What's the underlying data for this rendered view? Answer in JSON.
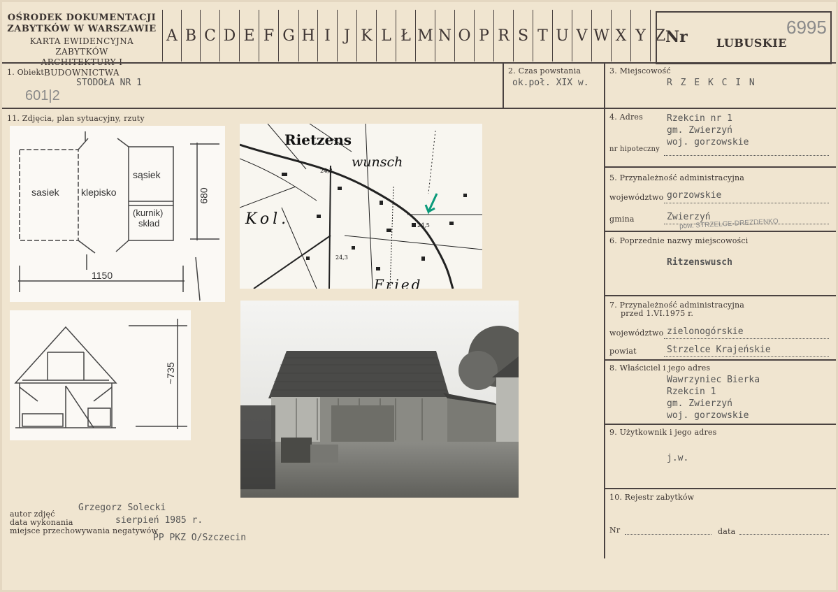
{
  "institution": {
    "line1": "OŚRODEK DOKUMENTACJI",
    "line2": "ZABYTKÓW W WARSZAWIE",
    "line3": "KARTA EWIDENCYJNA ZABYTKÓW",
    "line4": "ARCHITEKTURY I BUDOWNICTWA"
  },
  "letters": [
    "A",
    "B",
    "C",
    "D",
    "E",
    "F",
    "G",
    "H",
    "I",
    "J",
    "K",
    "L",
    "Ł",
    "M",
    "N",
    "O",
    "P",
    "R",
    "S",
    "T",
    "U",
    "V",
    "W",
    "X",
    "Y",
    "Z"
  ],
  "nr_box": {
    "label": "Nr",
    "region": "LUBUSKIE",
    "number": "6995"
  },
  "field1": {
    "label": "1. Obiekt",
    "value": "STODOŁA NR 1",
    "handwritten": "601|2"
  },
  "field2": {
    "label": "2. Czas powstania",
    "value": "ok.poł. XIX w."
  },
  "field3": {
    "label": "3. Miejscowość",
    "value": "R Z E K C I N"
  },
  "field11": {
    "label": "11. Zdjęcia, plan sytuacyjny, rzuty"
  },
  "field4": {
    "label": "4. Adres",
    "line1": "Rzekcin nr 1",
    "line2": "gm. Zwierzyń",
    "line3": "woj. gorzowskie",
    "hipo_label": "nr hipoteczny"
  },
  "field5": {
    "label": "5. Przynależność administracyjna",
    "woj_label": "województwo",
    "woj_value": "gorzowskie",
    "gmina_label": "gmina",
    "gmina_value": "Zwierzyń",
    "gmina_hand": "pow. STRZELCE-DREZDENKO"
  },
  "field6": {
    "label": "6. Poprzednie nazwy miejscowości",
    "value": "Ritzenswusch"
  },
  "field7": {
    "label1": "7. Przynależność administracyjna",
    "label2": "przed 1.VI.1975 r.",
    "woj_label": "województwo",
    "woj_value": "zielonogórskie",
    "powiat_label": "powiat",
    "powiat_value": "Strzelce Krajeńskie"
  },
  "field8": {
    "label": "8. Właściciel i jego adres",
    "line1": "Wawrzyniec Bierka",
    "line2": "Rzekcin 1",
    "line3": "gm. Zwierzyń",
    "line4": "woj. gorzowskie"
  },
  "field9": {
    "label": "9. Użytkownik i jego adres",
    "value": "j.w."
  },
  "field10": {
    "label": "10. Rejestr zabytków",
    "nr_label": "Nr",
    "data_label": "data"
  },
  "footer": {
    "autor_label": "autor zdjęć",
    "autor_value": "Grzegorz Solecki",
    "data_label": "data wykonania",
    "data_value": "sierpień 1985 r.",
    "miejsce_label": "miejsce przechowywania negatywów",
    "miejsce_value": "PP PKZ O/Szczecin"
  },
  "plan": {
    "room1": "sasiek",
    "room2": "klepisko",
    "room3": "sąsiek",
    "room4": "(kurnik)",
    "room5": "skład",
    "width": "1150",
    "depth": "680"
  },
  "section": {
    "height": "~735"
  },
  "map": {
    "label1": "Rietzens",
    "label2": "wunsch",
    "label3": "Kol.",
    "label4": "Fried",
    "spot1": "24,3",
    "spot2": "24,5",
    "spot3": "24,3"
  }
}
